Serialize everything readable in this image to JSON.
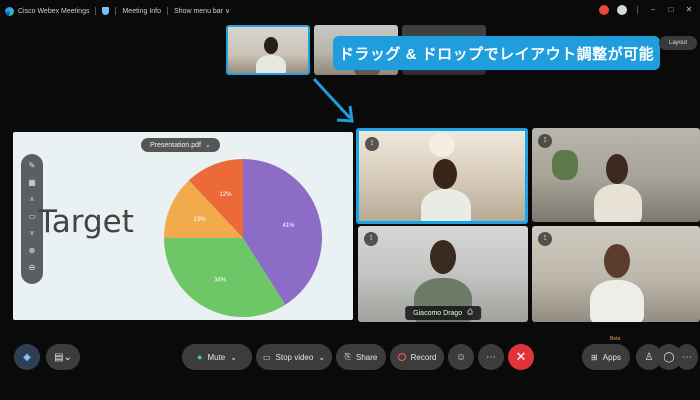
{
  "titlebar": {
    "app_name": "Cisco Webex Meetings",
    "meeting_info": "Meeting Info",
    "menu_bar": "Show menu bar",
    "menu_chevron": "∨",
    "window_buttons": [
      "−",
      "□",
      "✕"
    ]
  },
  "overlay": {
    "callout_text": "ドラッグ & ドロップでレイアウト調整が可能",
    "layout_label": "Layout"
  },
  "presentation": {
    "file_name": "Presentation.pdf",
    "file_chevron": "⌄",
    "slide_text": "Target",
    "toolbar_icons": [
      "pen-icon",
      "grid-icon",
      "chevron-up-icon",
      "page-icon",
      "chevron-down-icon",
      "zoom-in-icon",
      "zoom-out-icon"
    ],
    "pie_slices": [
      {
        "label": "41%",
        "value": 41,
        "color": "#8d6cc8"
      },
      {
        "label": "34%",
        "value": 34,
        "color": "#6ec766"
      },
      {
        "label": "13%",
        "value": 13,
        "color": "#f1aa4c"
      },
      {
        "label": "12%",
        "value": 12,
        "color": "#ec6a37"
      }
    ]
  },
  "tiles": [
    {
      "id": "tile-1",
      "active": true
    },
    {
      "id": "tile-2",
      "active": false
    },
    {
      "id": "tile-3",
      "active": false,
      "name": "Giacomo Drago"
    },
    {
      "id": "tile-4",
      "active": false
    }
  ],
  "controls": {
    "mute_label": "Mute",
    "mute_chevron": "⌄",
    "stop_video_label": "Stop video",
    "stop_video_chevron": "⌄",
    "share_label": "Share",
    "record_label": "Record",
    "apps_label": "Apps",
    "apps_badge": "Beta",
    "chat_chevron": "⌄"
  },
  "colors": {
    "accent": "#1f9ddc",
    "end_call": "#e0343a",
    "presentation_bg": "#e9f1f2"
  }
}
